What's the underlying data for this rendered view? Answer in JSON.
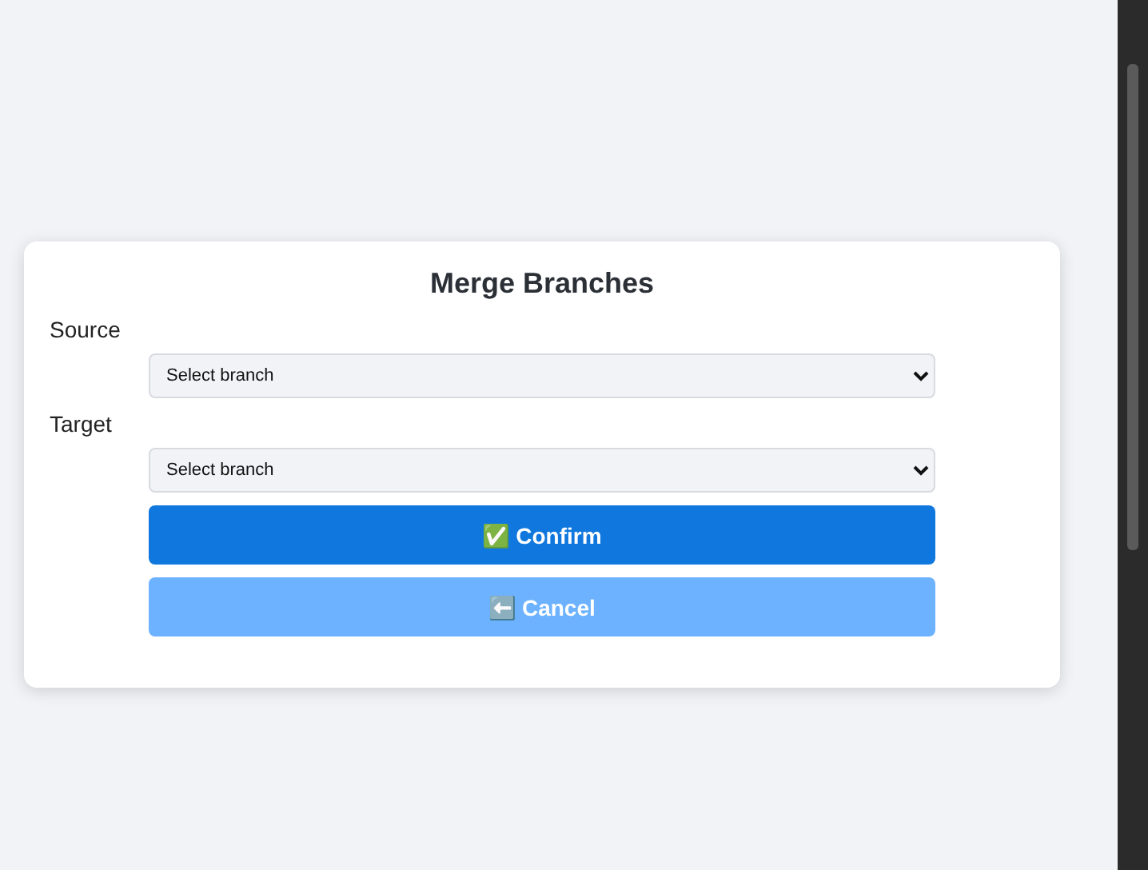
{
  "dialog": {
    "title": "Merge Branches",
    "fields": [
      {
        "label": "Source",
        "placeholder": "Select branch"
      },
      {
        "label": "Target",
        "placeholder": "Select branch"
      }
    ],
    "buttons": [
      {
        "label": "✅ Confirm",
        "kind": "primary"
      },
      {
        "label": "⬅️ Cancel",
        "kind": "secondary"
      }
    ]
  }
}
